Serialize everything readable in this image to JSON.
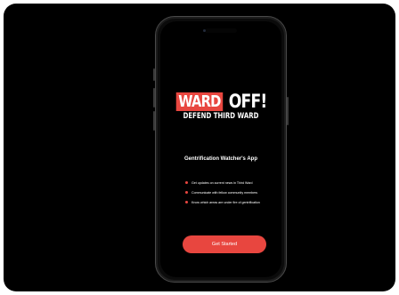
{
  "logo": {
    "highlight": "WARD",
    "rest": "OFF!",
    "tagline": "DEFEND THIRD WARD"
  },
  "app_title": "Gentrification Watcher's App",
  "features": [
    "Get updates on current news in Third Ward",
    "Communicate with fellow community members",
    "Know which areas are under fire of gentrification"
  ],
  "cta_label": "Get Started",
  "colors": {
    "accent": "#e8463f",
    "background": "#000000",
    "text": "#ffffff"
  }
}
